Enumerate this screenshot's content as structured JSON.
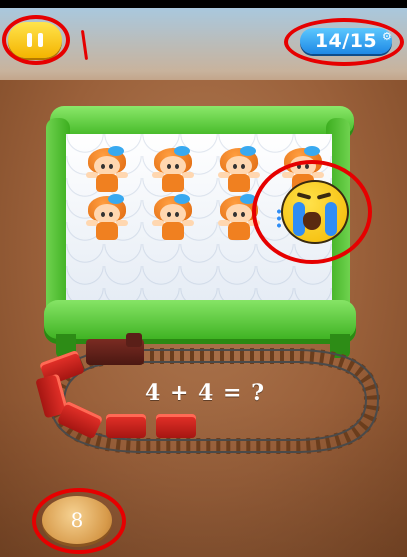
{
  "hud": {
    "level_text": "14/15",
    "pause_icon": "pause-icon"
  },
  "puzzle": {
    "equation": "4 + 4 = ?",
    "answer": "8"
  },
  "colors": {
    "annotation_red": "#e60000",
    "bed_green": "#3bb31f",
    "level_blue": "#1e88e5",
    "pause_yellow": "#f4b400",
    "train_red": "#c21f18"
  }
}
